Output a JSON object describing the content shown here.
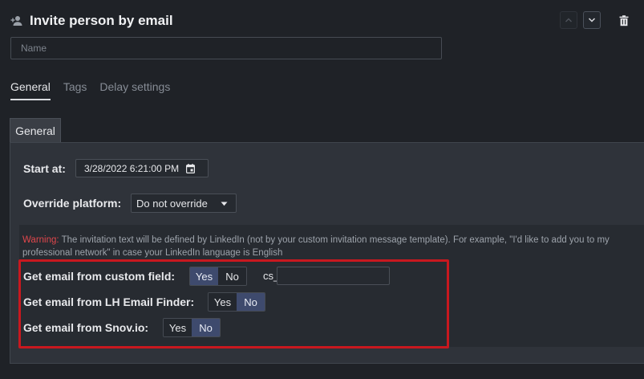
{
  "header": {
    "title": "Invite person by email",
    "icons": [
      "person-add-icon",
      "chevron-up-icon",
      "chevron-down-icon",
      "trash-icon"
    ]
  },
  "name_field": {
    "placeholder": "Name",
    "value": ""
  },
  "tabs": [
    {
      "label": "General",
      "active": true
    },
    {
      "label": "Tags",
      "active": false
    },
    {
      "label": "Delay settings",
      "active": false
    }
  ],
  "panel": {
    "tab_label": "General",
    "start_at": {
      "label": "Start at:",
      "value": "3/28/2022 6:21:00 PM"
    },
    "override_platform": {
      "label": "Override platform:",
      "selected": "Do not override"
    },
    "warning": {
      "prefix": "Warning:",
      "text": " The invitation text will be defined by LinkedIn (not by your custom invitation message template). For example, \"I'd like to add you to my professional network\" in case your LinkedIn language is English"
    },
    "email_options": [
      {
        "label": "Get email from custom field:",
        "yes": "Yes",
        "no": "No",
        "selected": "Yes"
      },
      {
        "label": "Get email from LH Email Finder:",
        "yes": "Yes",
        "no": "No",
        "selected": "No"
      },
      {
        "label": "Get email from Snov.io:",
        "yes": "Yes",
        "no": "No",
        "selected": "No"
      }
    ],
    "custom_field": {
      "prefix": "cs_",
      "value": ""
    }
  },
  "colors": {
    "background": "#1f2227",
    "panel": "#2f333a",
    "toggle_selected": "#3e4a6d",
    "warning": "#e0474c",
    "highlight_border": "#c8181f"
  }
}
